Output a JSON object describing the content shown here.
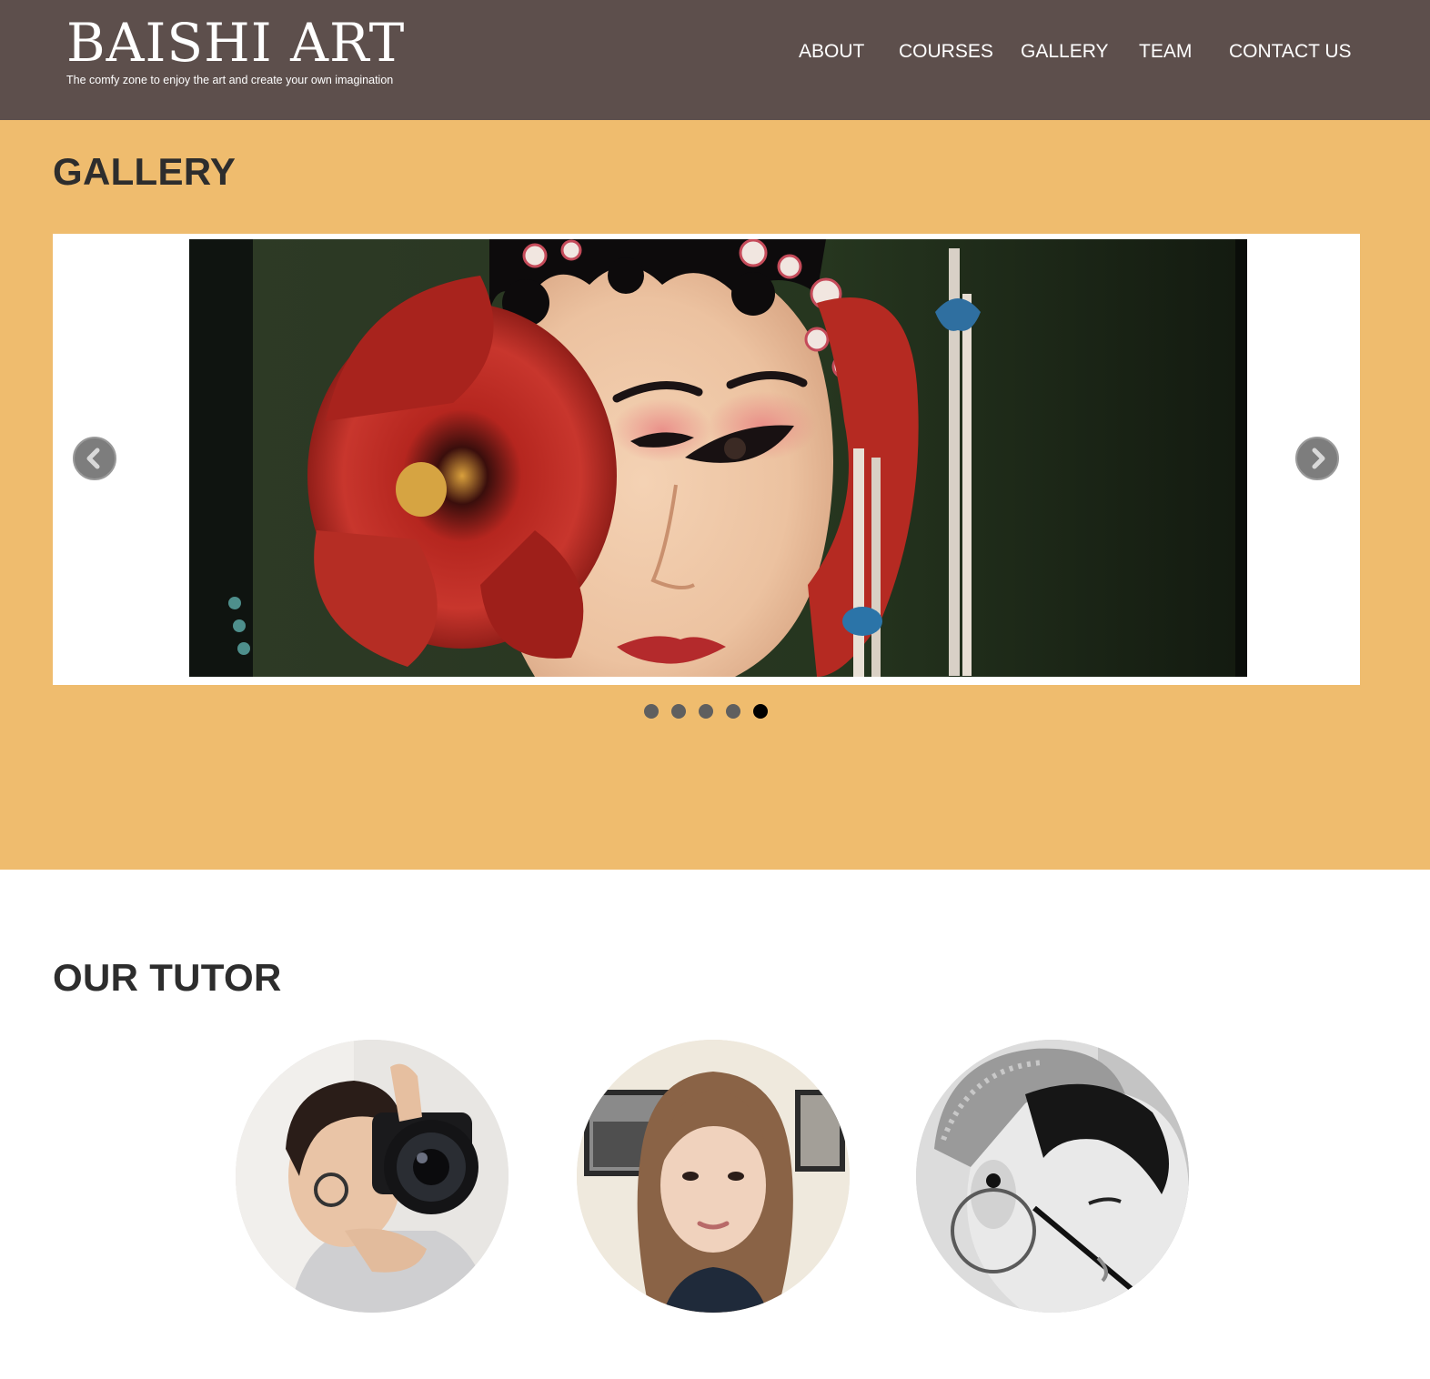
{
  "header": {
    "brand_title": "BAISHI ART",
    "tagline": "The comfy zone to enjoy the art and create your own imagination",
    "nav": {
      "about": "ABOUT",
      "courses": "COURSES",
      "gallery": "GALLERY",
      "team": "TEAM",
      "contact": "CONTACT US"
    }
  },
  "gallery": {
    "heading": "GALLERY",
    "slider": {
      "prev_icon": "chevron-left-icon",
      "next_icon": "chevron-right-icon",
      "slide_count": 5,
      "active_slide": 5
    }
  },
  "tutors": {
    "heading": "OUR TUTOR",
    "count": 3
  },
  "colors": {
    "header_bg": "#5d4f4c",
    "gallery_bg": "#efbc6e",
    "heading_text": "#2d2d2d",
    "dot_inactive": "#5f5f5f",
    "dot_active": "#000000"
  }
}
